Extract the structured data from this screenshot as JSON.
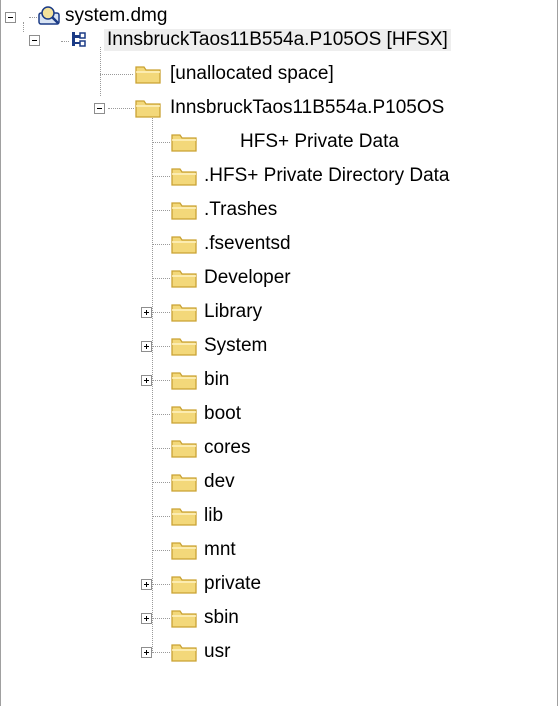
{
  "tree": {
    "root": {
      "label": "system.dmg",
      "icon": "disk-image-icon",
      "expanded": true
    },
    "partition": {
      "label": "InnsbruckTaos11B554a.P105OS [HFSX]",
      "icon": "partition-icon",
      "expanded": true
    },
    "children": [
      {
        "label": "[unallocated space]",
        "icon": "folder-icon"
      },
      {
        "label": "InnsbruckTaos11B554a.P105OS",
        "icon": "folder-icon",
        "expanded": true
      }
    ],
    "volume_items": [
      {
        "label": "\u0000\u0000\u0000\u0000HFS+ Private Data",
        "display": "     HFS+ Private Data",
        "expandable": false
      },
      {
        "label": ".HFS+ Private Directory Data",
        "expandable": false
      },
      {
        "label": ".Trashes",
        "expandable": false
      },
      {
        "label": ".fseventsd",
        "expandable": false
      },
      {
        "label": "Developer",
        "expandable": false
      },
      {
        "label": "Library",
        "expandable": true
      },
      {
        "label": "System",
        "expandable": true
      },
      {
        "label": "bin",
        "expandable": true
      },
      {
        "label": "boot",
        "expandable": false
      },
      {
        "label": "cores",
        "expandable": false
      },
      {
        "label": "dev",
        "expandable": false
      },
      {
        "label": "lib",
        "expandable": false
      },
      {
        "label": "mnt",
        "expandable": false
      },
      {
        "label": "private",
        "expandable": true
      },
      {
        "label": "sbin",
        "expandable": true
      },
      {
        "label": "usr",
        "expandable": true
      }
    ]
  }
}
